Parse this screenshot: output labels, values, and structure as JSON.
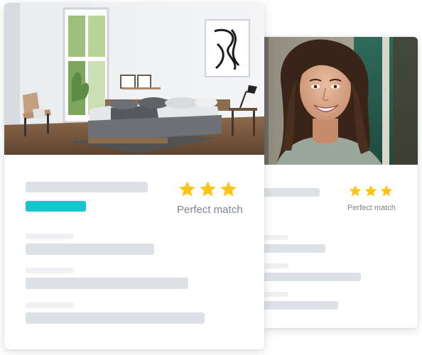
{
  "cards": [
    {
      "id": "person",
      "photo_subject": "smiling-woman-portrait",
      "rating_stars": 3,
      "match_label": "Perfect match"
    },
    {
      "id": "room",
      "photo_subject": "bright-bedroom",
      "rating_stars": 3,
      "match_label": "Perfect match"
    }
  ],
  "colors": {
    "accent": "#17c4cc",
    "star": "#fcc419",
    "skeleton_dark": "#dde1e6",
    "skeleton_light": "#eef0f3",
    "label": "#7d8590"
  }
}
